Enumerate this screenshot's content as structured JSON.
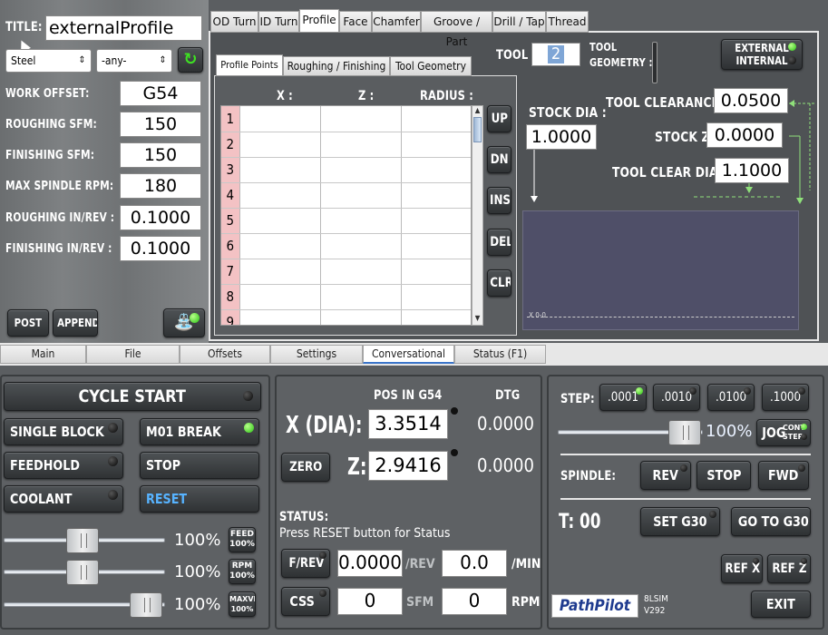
{
  "top_left": {
    "title_label": "TITLE:",
    "title_value": "externalProfile",
    "material_select": "Steel",
    "grade_select": "-any-",
    "fields": [
      {
        "label": "WORK OFFSET:",
        "value": "G54"
      },
      {
        "label": "ROUGHING SFM:",
        "value": "150"
      },
      {
        "label": "FINISHING SFM:",
        "value": "150"
      },
      {
        "label": "MAX SPINDLE RPM:",
        "value": "180"
      },
      {
        "label": "ROUGHING IN/REV :",
        "value": "0.1000"
      },
      {
        "label": "FINISHING IN/REV :",
        "value": "0.1000"
      }
    ],
    "post_label": "POST",
    "append_label": "APPEND"
  },
  "conv_tabs": [
    "OD Turn",
    "ID Turn",
    "Profile",
    "Face",
    "Chamfer",
    "Groove / Part",
    "Drill / Tap",
    "Thread"
  ],
  "profile_subtabs": [
    "Profile Points",
    "Roughing / Finishing",
    "Tool Geometry"
  ],
  "table": {
    "headers": [
      "X :",
      "Z :",
      "RADIUS :"
    ],
    "rows": [
      "1",
      "2",
      "3",
      "4",
      "5",
      "6",
      "7",
      "8",
      "9"
    ]
  },
  "table_buttons": [
    "UP",
    "DN",
    "INS",
    "DEL",
    "CLR"
  ],
  "tool": {
    "tool_label": "TOOL :",
    "tool_value": "2",
    "geometry_label_1": "TOOL",
    "geometry_label_2": "GEOMETRY :",
    "external_label": "EXTERNAL",
    "internal_label": "INTERNAL",
    "stock_dia_label": "STOCK DIA :",
    "stock_dia_value": "1.0000",
    "clearance_z_label": "TOOL CLEARANCE Z :",
    "clearance_z_value": "0.0500",
    "stock_z_label": "STOCK Z :",
    "stock_z_value": "0.0000",
    "clear_dia_x_label": "TOOL CLEAR DIA X :",
    "clear_dia_x_value": "1.1000",
    "preview_axis_label": "X 0-0"
  },
  "main_tabs": [
    "Main",
    "File",
    "Offsets",
    "Settings",
    "Conversational",
    "Status (F1)"
  ],
  "cycle": {
    "cycle_start": "CYCLE START",
    "single_block": "SINGLE BLOCK",
    "m01_break": "M01 BREAK",
    "feedhold": "FEEDHOLD",
    "stop": "STOP",
    "coolant": "COOLANT",
    "reset": "RESET",
    "overrides": [
      {
        "pct": "100%",
        "label_1": "FEED",
        "label_2": "100%",
        "value": 0.45
      },
      {
        "pct": "100%",
        "label_1": "RPM",
        "label_2": "100%",
        "value": 0.45
      },
      {
        "pct": "100%",
        "label_1": "MAXVEL",
        "label_2": "100%",
        "value": 1.0
      }
    ]
  },
  "dro": {
    "pos_header": "POS IN G54",
    "dtg_header": "DTG",
    "x_label": "X (DIA):",
    "x_value": "3.3514",
    "x_dtg": "0.0000",
    "zero_label": "ZERO",
    "z_label": "Z:",
    "z_value": "2.9416",
    "z_dtg": "0.0000",
    "status_label": "STATUS:",
    "status_text": "Press RESET button for Status",
    "frev_label": "F/REV",
    "frev_value": "0.0000",
    "rev_unit": "/REV",
    "min_value": "0.0",
    "min_unit": "/MIN",
    "css_label": "CSS",
    "sfm_value": "0",
    "sfm_unit": "SFM",
    "rpm_value": "0",
    "rpm_unit": "RPM"
  },
  "jog": {
    "step_label": "STEP:",
    "steps": [
      ".0001",
      ".0010",
      ".0100",
      ".1000"
    ],
    "jog_pct": "100%",
    "jog_label": "JOG",
    "cont_label": "CONT",
    "step_small": "STEP",
    "jog_value": 0.75,
    "spindle_label": "SPINDLE:",
    "rev_label": "REV",
    "stop_label": "STOP",
    "fwd_label": "FWD",
    "t_label": "T: 00",
    "set_g30": "SET G30",
    "go_to_g30": "GO TO G30",
    "ref_x": "REF X",
    "ref_z": "REF Z",
    "logo": "PathPilot",
    "version_1": "8LSIM",
    "version_2": "V292",
    "exit_label": "EXIT"
  }
}
